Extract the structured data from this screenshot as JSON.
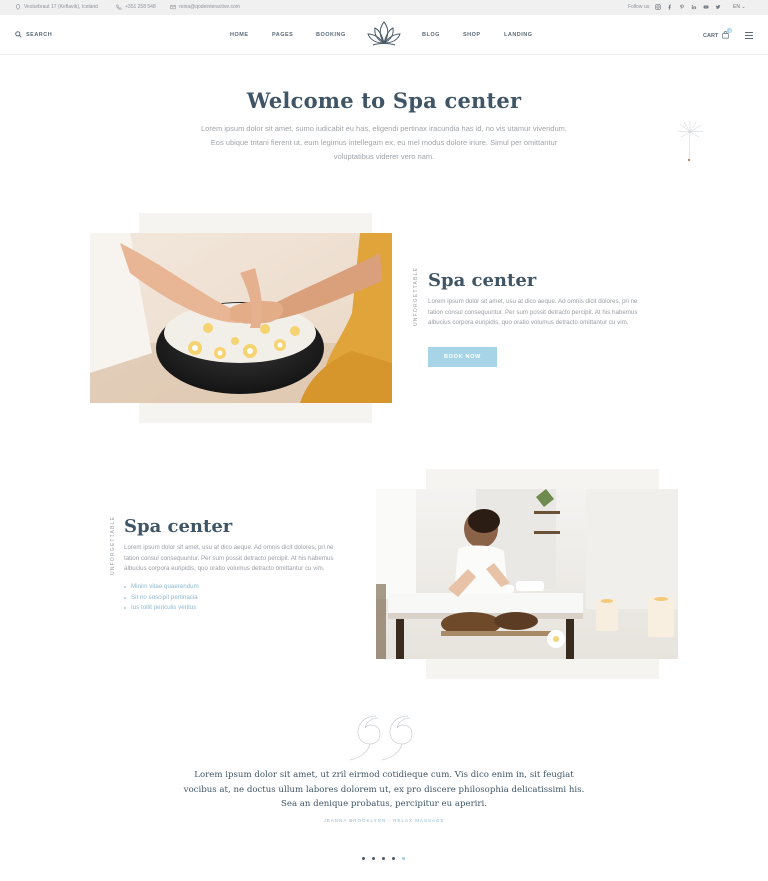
{
  "topbar": {
    "address": "Vesturbraut 17 (Keflavík), Iceland",
    "phone": "+351 258 548",
    "email": "reina@qodeinteractive.com",
    "follow_label": "Follow us:",
    "social_icons": [
      "instagram-icon",
      "facebook-icon",
      "pinterest-icon",
      "linkedin-icon",
      "youtube-icon",
      "twitter-icon"
    ],
    "language": "EN"
  },
  "header": {
    "search_label": "SEARCH",
    "nav": [
      "HOME",
      "PAGES",
      "BOOKING",
      "BLOG",
      "SHOP",
      "LANDING"
    ],
    "cart_label": "CART",
    "cart_count": "0"
  },
  "welcome": {
    "title": "Welcome to Spa center",
    "text": "Lorem ipsum dolor sit amet, sumo iudicabit eu has, eligendi pertinax iracundia has id, no vis utamur vivendum. Eos ubique tritani fierent ut, eum legimus intellegam ex, eu mel modus dolore iriure. Simul per omittantur voluptatibus viderer vero nam."
  },
  "section1": {
    "vertical_label": "UNFORGETTABLE",
    "title": "Spa center",
    "text": "Lorem ipsum dolor sit amet, usu at dico aeque. Ad omnis dicit dolores, pri ne tation consul consequuntur. Per sum possit detracto percipit. At his habemus albucius corpora euripidis, quo oratio volumus detracto omittantur cu vim.",
    "button_label": "BOOK NOW"
  },
  "section2": {
    "vertical_label": "UNFORGETTABLE",
    "title": "Spa center",
    "text": "Lorem ipsum dolor sit amet, usu at dico aeque. Ad omnis dicit dolores, pri ne tation consul consequuntur. Per sum possit detracto percipit. At his habemus albucius corpora euripidis, quo oratio volumus detracto omittantur cu vim.",
    "bullets": [
      "Minim vitae quaerendum",
      "Sit no suscipit pertinacia",
      "Ius tollit periculis veritus"
    ]
  },
  "testimonial": {
    "quote": "Lorem ipsum dolor sit amet, ut zril eirmod cotidieque cum. Vis dico enim in, sit feugiat vocibus at, ne doctus ullum labores dolorem ut, ex pro discere philosophia delicatissimi his. Sea an denique probatus, percipitur eu aperiri.",
    "author": "JEANNA BROOKLYNN - RELAX MASSAGE",
    "slides": 5,
    "active_slide": 5
  },
  "colors": {
    "heading": "#3f5566",
    "accent": "#a7d4e6",
    "panel": "#f6f4f1"
  }
}
